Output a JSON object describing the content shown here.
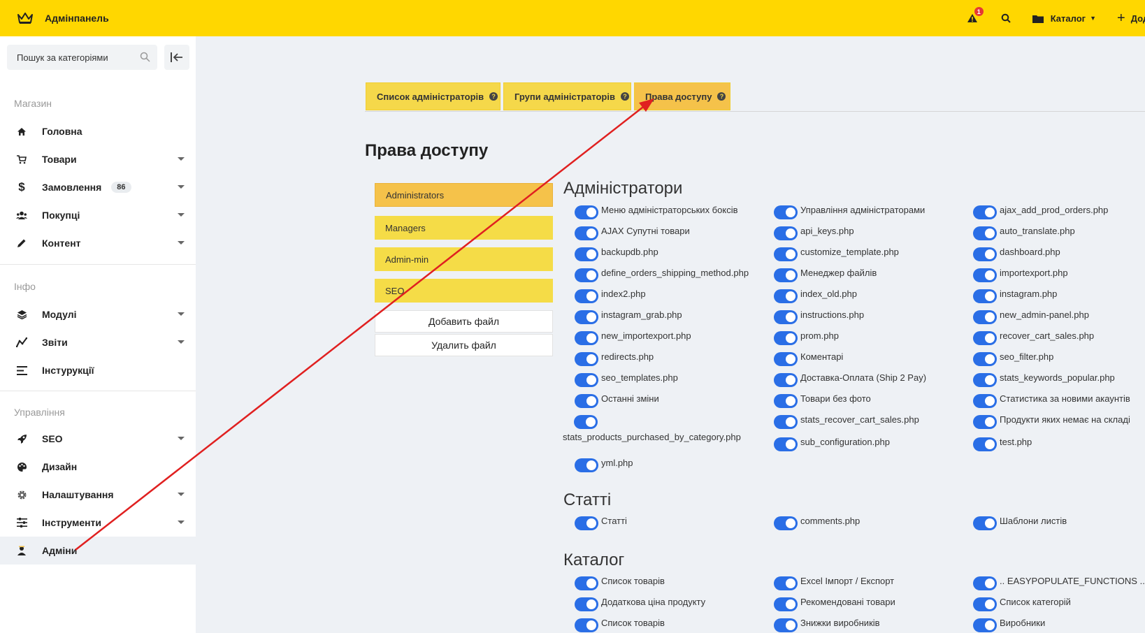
{
  "topbar": {
    "title": "Адмінпанель",
    "alert_count": "1",
    "catalog_label": "Каталог",
    "add_label": "Додати"
  },
  "sidebar": {
    "search_placeholder": "Пошук за категоріями",
    "sections": {
      "shop": "Магазин",
      "info": "Інфо",
      "manage": "Управління"
    },
    "items": {
      "home": "Головна",
      "products": "Товари",
      "orders": "Замовлення",
      "orders_count": "86",
      "customers": "Покупці",
      "content": "Контент",
      "modules": "Модулі",
      "reports": "Звіти",
      "instructions": "Інстурукції",
      "seo": "SEO",
      "design": "Дизайн",
      "settings": "Налаштування",
      "tools": "Інструменти",
      "admins": "Адміни"
    }
  },
  "tabs": {
    "list": "Список адміністраторів",
    "groups": "Групи адміністраторів",
    "rights": "Права доступу"
  },
  "page_title": "Права доступу",
  "groups": [
    "Administrators",
    "Managers",
    "Admin-min",
    "SEO"
  ],
  "file_buttons": {
    "add": "Добавить файл",
    "remove": "Удалить файл"
  },
  "sections": {
    "admins": {
      "title": "Адміністратори",
      "items": [
        "Меню адміністраторських боксів",
        "Управління адміністраторами",
        "ajax_add_prod_orders.php",
        "AJAX Супутні товари",
        "api_keys.php",
        "auto_translate.php",
        "backupdb.php",
        "customize_template.php",
        "dashboard.php",
        "define_orders_shipping_method.php",
        "Менеджер файлів",
        "importexport.php",
        "index2.php",
        "index_old.php",
        "instagram.php",
        "instagram_grab.php",
        "instructions.php",
        "new_admin-panel.php",
        "new_importexport.php",
        "prom.php",
        "recover_cart_sales.php",
        "redirects.php",
        "Коментарі",
        "seo_filter.php",
        "seo_templates.php",
        "Доставка-Оплата (Ship 2 Pay)",
        "stats_keywords_popular.php",
        "Останні зміни",
        "Товари без фото",
        "Статистика за новими акаунтів",
        "stats_products_purchased_by_category.php",
        "stats_recover_cart_sales.php",
        "Продукти яких немає на складі",
        "yml.php",
        "sub_configuration.php",
        "test.php"
      ]
    },
    "articles": {
      "title": "Статті",
      "items": [
        "Статті",
        "comments.php",
        "Шаблони листів"
      ]
    },
    "catalog": {
      "title": "Каталог",
      "items": [
        "Список товарів",
        "Excel Імпорт / Експорт",
        ".. EASYPOPULATE_FUNCTIONS ..",
        "Додаткова ціна продукту",
        "Рекомендовані товари",
        "Список категорій",
        "Список товарів",
        "Знижки виробників",
        "Виробники"
      ]
    }
  },
  "colors": {
    "topbar": "#ffd700",
    "tab": "#f5d84a",
    "tab_active": "#f5c24a",
    "toggle": "#2a6ee6",
    "arrow": "#e02020"
  }
}
